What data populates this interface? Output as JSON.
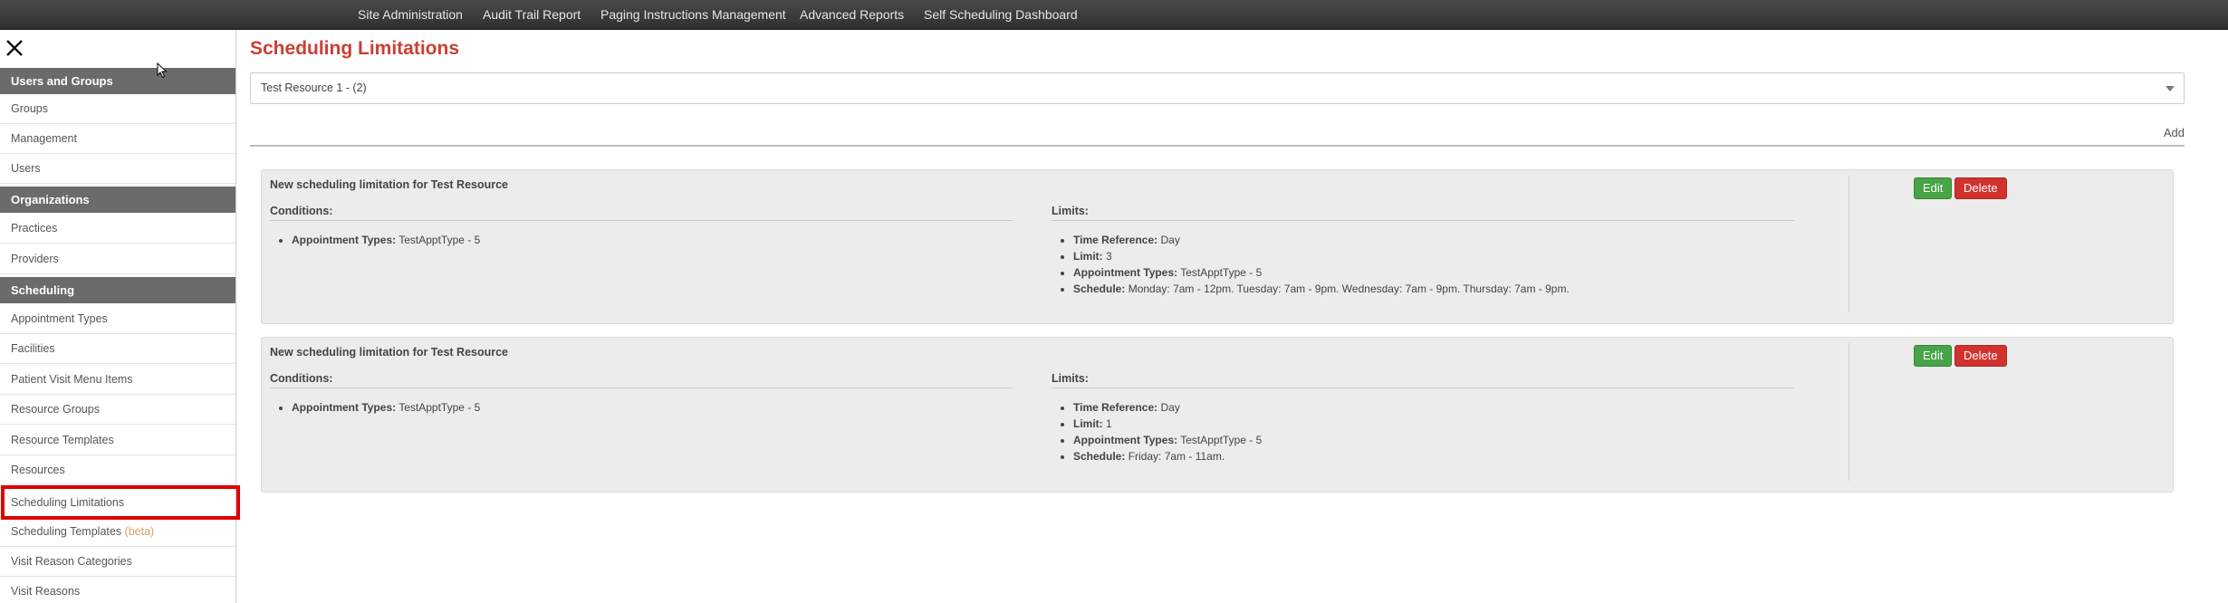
{
  "topnav": [
    {
      "label": "Site Administration"
    },
    {
      "label": "Audit Trail Report"
    },
    {
      "label": "Paging Instructions Management"
    },
    {
      "label": "Advanced Reports"
    },
    {
      "label": "Self Scheduling Dashboard"
    }
  ],
  "sidebar": {
    "sections": [
      {
        "label": "Users and Groups",
        "items": [
          "Groups",
          "Management",
          "Users"
        ]
      },
      {
        "label": "Organizations",
        "items": [
          "Practices",
          "Providers"
        ]
      },
      {
        "label": "Scheduling",
        "items": [
          "Appointment Types",
          "Facilities",
          "Patient Visit Menu Items",
          "Resource Groups",
          "Resource Templates",
          "Resources",
          "Scheduling Limitations",
          "Scheduling Templates",
          "Visit Reason Categories",
          "Visit Reasons"
        ]
      }
    ],
    "beta_label": "(beta)",
    "active_item": "Scheduling Limitations",
    "highlight_color": "#e00000"
  },
  "page": {
    "title": "Scheduling Limitations",
    "resource_select": "Test Resource 1 - (2)",
    "add_label": "Add",
    "title_color": "#c94032"
  },
  "limitations": [
    {
      "title": "New scheduling limitation for Test Resource",
      "conditions_label": "Conditions:",
      "limits_label": "Limits:",
      "conditions": [
        {
          "key": "Appointment Types:",
          "value": "TestApptType - 5"
        }
      ],
      "limits": [
        {
          "key": "Time Reference:",
          "value": "Day"
        },
        {
          "key": "Limit:",
          "value": "3"
        },
        {
          "key": "Appointment Types:",
          "value": "TestApptType - 5"
        },
        {
          "key": "Schedule:",
          "value": "Monday: 7am - 12pm. Tuesday: 7am - 9pm. Wednesday: 7am - 9pm. Thursday: 7am - 9pm."
        }
      ],
      "edit_label": "Edit",
      "delete_label": "Delete"
    },
    {
      "title": "New scheduling limitation for Test Resource",
      "conditions_label": "Conditions:",
      "limits_label": "Limits:",
      "conditions": [
        {
          "key": "Appointment Types:",
          "value": "TestApptType - 5"
        }
      ],
      "limits": [
        {
          "key": "Time Reference:",
          "value": "Day"
        },
        {
          "key": "Limit:",
          "value": "1"
        },
        {
          "key": "Appointment Types:",
          "value": "TestApptType - 5"
        },
        {
          "key": "Schedule:",
          "value": "Friday: 7am - 11am."
        }
      ],
      "edit_label": "Edit",
      "delete_label": "Delete"
    }
  ]
}
